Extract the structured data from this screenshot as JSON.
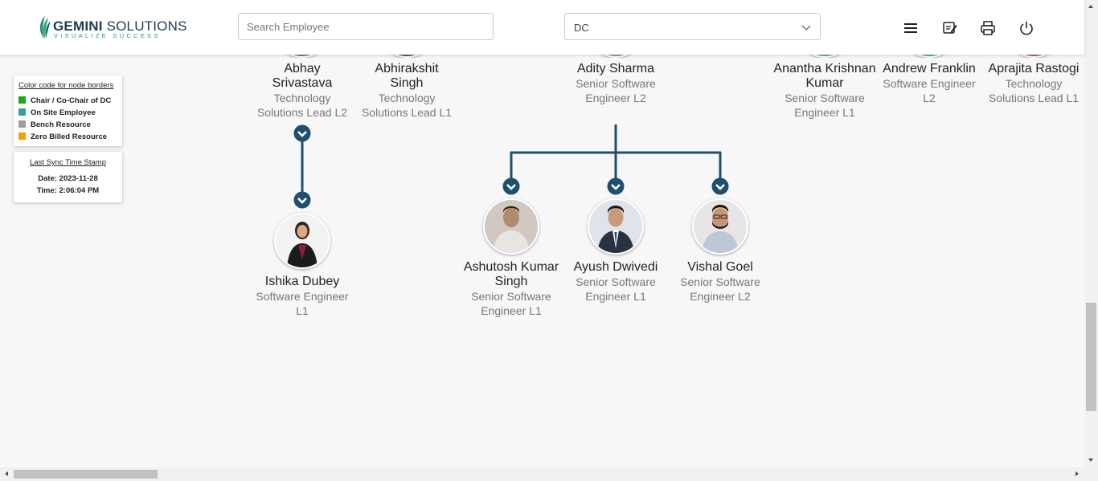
{
  "header": {
    "logo": {
      "brand_bold": "GEMINI",
      "brand_rest": " SOLUTIONS",
      "tagline": "VISUALIZE SUCCESS"
    },
    "search": {
      "placeholder": "Search Employee",
      "value": ""
    },
    "department_select": {
      "value": "DC"
    },
    "icons": [
      "menu-icon",
      "notes-icon",
      "print-icon",
      "power-icon"
    ]
  },
  "legend": {
    "title": "Color code for node borders",
    "items": [
      {
        "label": "Chair / Co-Chair of DC",
        "color": "#1aaa1a"
      },
      {
        "label": "On Site Employee",
        "color": "#3a9e9e"
      },
      {
        "label": "Bench Resource",
        "color": "#9e9e9e"
      },
      {
        "label": "Zero Billed Resource",
        "color": "#f0a20a"
      }
    ]
  },
  "sync": {
    "title": "Last Sync Time Stamp",
    "date": "Date: 2023-11-28",
    "time": "Time: 2:06:04 PM"
  },
  "org": {
    "top_row": [
      {
        "name": "Abhay Srivastava",
        "role": "Technology Solutions Lead L2"
      },
      {
        "name": "Abhirakshit Singh",
        "role": "Technology Solutions Lead L1"
      },
      {
        "name": "Adity Sharma",
        "role": "Senior Software Engineer L2"
      },
      {
        "name": "Anantha Krishnan Kumar",
        "role": "Senior Software Engineer L1"
      },
      {
        "name": "Andrew Franklin",
        "role": "Software Engineer L2"
      },
      {
        "name": "Aprajita Rastogi",
        "role": "Technology Solutions Lead L1"
      }
    ],
    "children_abhay": [
      {
        "name": "Ishika Dubey",
        "role": "Software Engineer L1"
      }
    ],
    "children_adity": [
      {
        "name": "Ashutosh Kumar Singh",
        "role": "Senior Software Engineer L1"
      },
      {
        "name": "Ayush Dwivedi",
        "role": "Senior Software Engineer L1"
      },
      {
        "name": "Vishal Goel",
        "role": "Senior Software Engineer L2"
      }
    ]
  },
  "colors": {
    "connector": "#1f4e6e",
    "accent": "#2a8c8c"
  }
}
